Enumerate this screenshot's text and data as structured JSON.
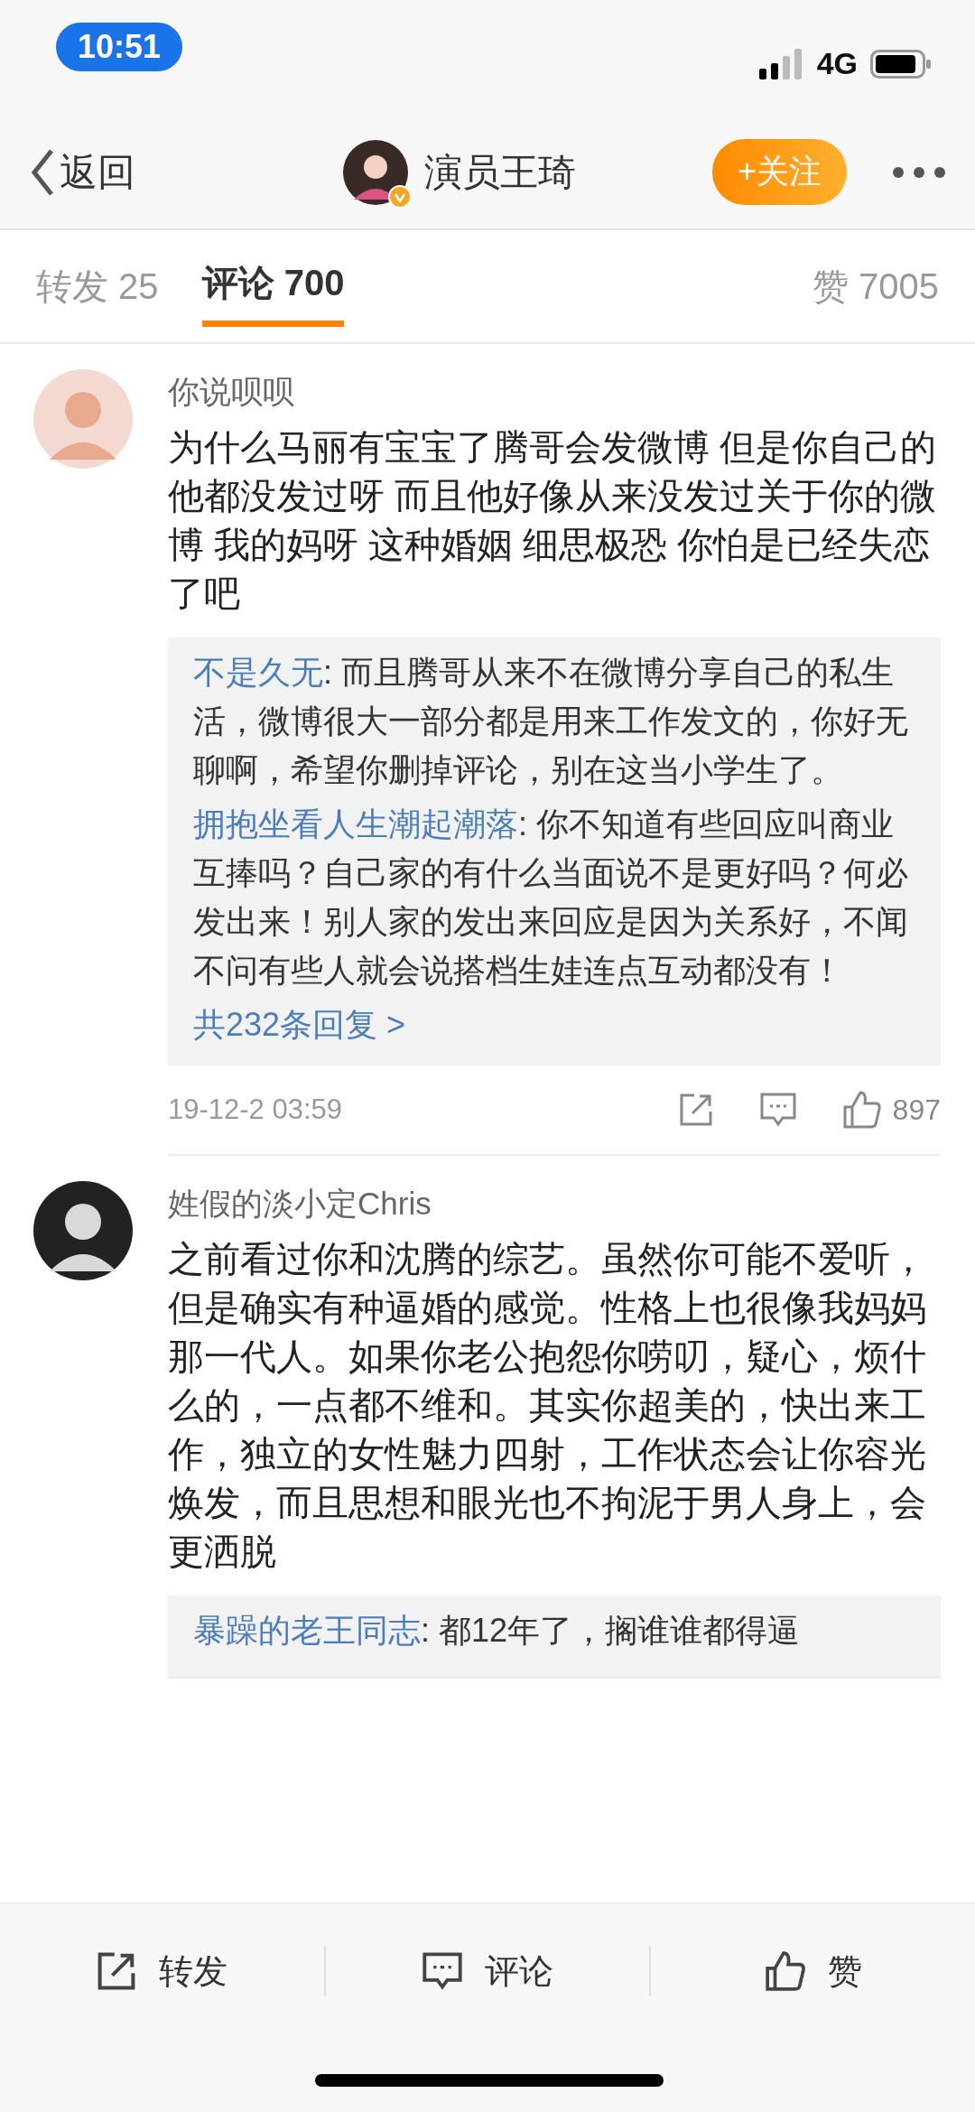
{
  "status_bar": {
    "time": "10:51",
    "network": "4G"
  },
  "nav": {
    "back": "返回",
    "title": "演员王琦",
    "verified": true,
    "follow": "+关注"
  },
  "tabs": [
    {
      "label": "转发 25",
      "selected": false
    },
    {
      "label": "评论 700",
      "selected": true
    },
    {
      "label": "赞 7005",
      "selected": false
    }
  ],
  "comments": [
    {
      "user": "你说呗呗",
      "text": "为什么马丽有宝宝了腾哥会发微博 但是你自己的他都没发过呀 而且他好像从来没发过关于你的微博 我的妈呀 这种婚姻 细思极恐 你怕是已经失恋了吧",
      "replies": [
        {
          "user": "不是久无",
          "text": ": 而且腾哥从来不在微博分享自己的私生活，微博很大一部分都是用来工作发文的，你好无聊啊，希望你删掉评论，别在这当小学生了。"
        },
        {
          "user": "拥抱坐看人生潮起潮落",
          "text": ": 你不知道有些回应叫商业互捧吗？自己家的有什么当面说不是更好吗？何必发出来！别人家的发出来回应是因为关系好，不闻不问有些人就会说搭档生娃连点互动都没有！"
        }
      ],
      "more": "共232条回复 >",
      "time": "19-12-2 03:59",
      "likes": "897"
    },
    {
      "user": "姓假的淡小定Chris",
      "text": "之前看过你和沈腾的综艺。虽然你可能不爱听，但是确实有种逼婚的感觉。性格上也很像我妈妈那一代人。如果你老公抱怨你唠叨，疑心，烦什么的，一点都不维和。其实你超美的，快出来工作，独立的女性魅力四射，工作状态会让你容光焕发，而且思想和眼光也不拘泥于男人身上，会更洒脱",
      "replies": [
        {
          "user": "暴躁的老王同志",
          "text": ": 都12年了，搁谁谁都得逼"
        }
      ]
    }
  ],
  "actions": [
    {
      "kind": "share",
      "label": "转发"
    },
    {
      "kind": "comment",
      "label": "评论"
    },
    {
      "kind": "like",
      "label": "赞"
    }
  ]
}
